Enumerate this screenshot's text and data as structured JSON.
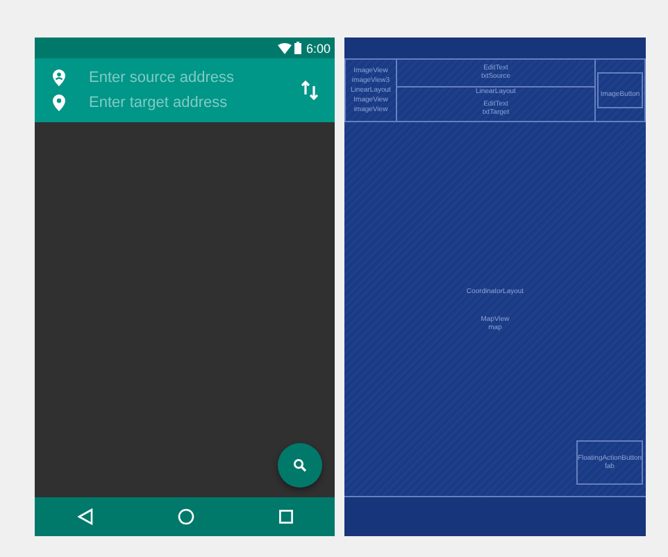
{
  "design": {
    "status_bar": {
      "time": "6:00"
    },
    "fields": [
      {
        "kind": "source",
        "placeholder": "Enter source address"
      },
      {
        "kind": "target",
        "placeholder": "Enter target address"
      }
    ]
  },
  "blueprint": {
    "left_labels": [
      "ImageView",
      "imageView3",
      "LinearLayout",
      "ImageView",
      "imageView"
    ],
    "source_labels": [
      "EditText",
      "txtSource"
    ],
    "center_label": "LinearLayout",
    "target_labels": [
      "EditText",
      "txtTarget"
    ],
    "button_label": "ImageButton",
    "root_label": "CoordinatorLayout",
    "map_labels": [
      "MapView",
      "map"
    ],
    "fab_labels": [
      "FloatingActionButton",
      "fab"
    ]
  }
}
